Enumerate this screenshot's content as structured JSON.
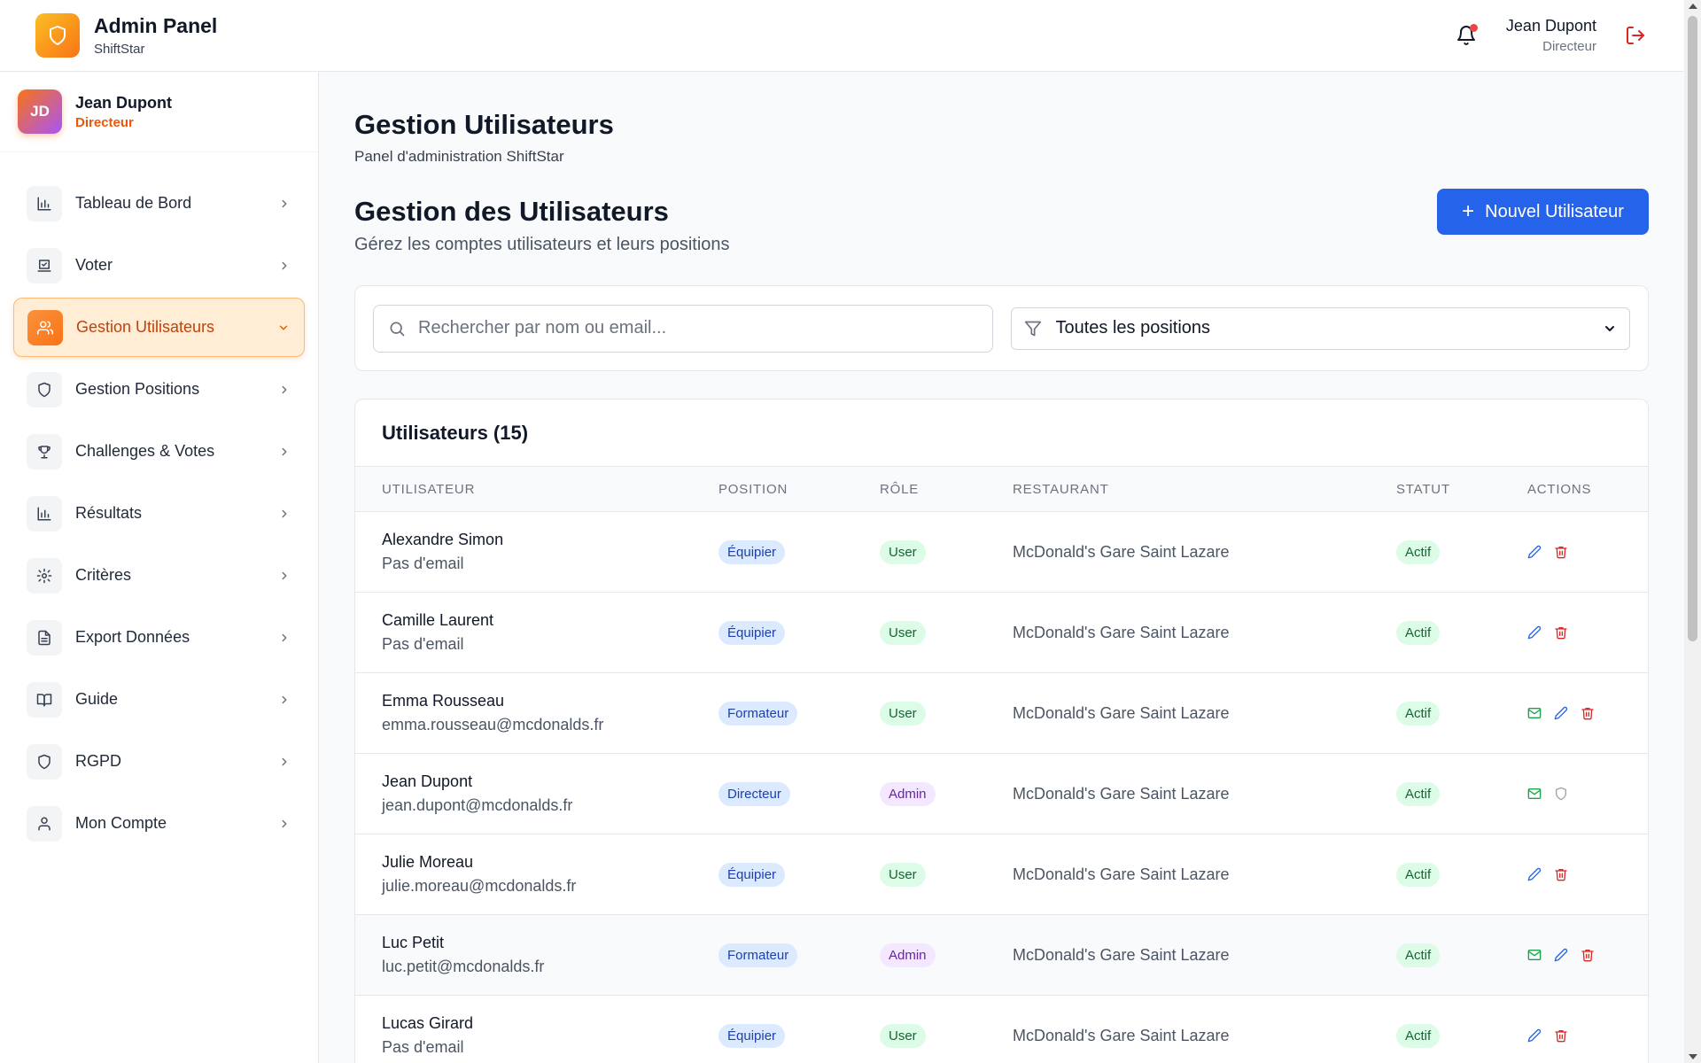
{
  "header": {
    "title": "Admin Panel",
    "subtitle": "ShiftStar",
    "user_name": "Jean Dupont",
    "user_role": "Directeur",
    "icons": {
      "logo": "shield-icon",
      "notifications": "bell-icon",
      "logout": "logout-icon"
    }
  },
  "sidebar": {
    "profile": {
      "initials": "JD",
      "name": "Jean Dupont",
      "role": "Directeur"
    },
    "items": [
      {
        "label": "Tableau de Bord",
        "icon": "bar-chart-icon",
        "active": false
      },
      {
        "label": "Voter",
        "icon": "vote-icon",
        "active": false
      },
      {
        "label": "Gestion Utilisateurs",
        "icon": "users-icon",
        "active": true
      },
      {
        "label": "Gestion Positions",
        "icon": "shield-icon",
        "active": false
      },
      {
        "label": "Challenges & Votes",
        "icon": "trophy-icon",
        "active": false
      },
      {
        "label": "Résultats",
        "icon": "bar-chart-icon",
        "active": false
      },
      {
        "label": "Critères",
        "icon": "gear-icon",
        "active": false
      },
      {
        "label": "Export Données",
        "icon": "file-text-icon",
        "active": false
      },
      {
        "label": "Guide",
        "icon": "book-icon",
        "active": false
      },
      {
        "label": "RGPD",
        "icon": "shield-icon",
        "active": false
      },
      {
        "label": "Mon Compte",
        "icon": "user-icon",
        "active": false
      }
    ]
  },
  "main": {
    "page_title": "Gestion Utilisateurs",
    "page_subtitle": "Panel d'administration ShiftStar",
    "section_title": "Gestion des Utilisateurs",
    "section_subtitle": "Gérez les comptes utilisateurs et leurs positions",
    "new_button": "Nouvel Utilisateur",
    "search_placeholder": "Rechercher par nom ou email...",
    "filter_value": "Toutes les positions",
    "table_title": "Utilisateurs (15)",
    "columns": [
      "UTILISATEUR",
      "POSITION",
      "RÔLE",
      "RESTAURANT",
      "STATUT",
      "ACTIONS"
    ],
    "rows": [
      {
        "name": "Alexandre Simon",
        "email": "Pas d'email",
        "position": "Équipier",
        "role": "User",
        "restaurant": "McDonald's Gare Saint Lazare",
        "status": "Actif",
        "actions": [
          "edit",
          "delete"
        ]
      },
      {
        "name": "Camille Laurent",
        "email": "Pas d'email",
        "position": "Équipier",
        "role": "User",
        "restaurant": "McDonald's Gare Saint Lazare",
        "status": "Actif",
        "actions": [
          "edit",
          "delete"
        ]
      },
      {
        "name": "Emma Rousseau",
        "email": "emma.rousseau@mcdonalds.fr",
        "position": "Formateur",
        "role": "User",
        "restaurant": "McDonald's Gare Saint Lazare",
        "status": "Actif",
        "actions": [
          "mail",
          "edit",
          "delete"
        ]
      },
      {
        "name": "Jean Dupont",
        "email": "jean.dupont@mcdonalds.fr",
        "position": "Directeur",
        "role": "Admin",
        "restaurant": "McDonald's Gare Saint Lazare",
        "status": "Actif",
        "actions": [
          "mail",
          "shield"
        ]
      },
      {
        "name": "Julie Moreau",
        "email": "julie.moreau@mcdonalds.fr",
        "position": "Équipier",
        "role": "User",
        "restaurant": "McDonald's Gare Saint Lazare",
        "status": "Actif",
        "actions": [
          "edit",
          "delete"
        ]
      },
      {
        "name": "Luc Petit",
        "email": "luc.petit@mcdonalds.fr",
        "position": "Formateur",
        "role": "Admin",
        "restaurant": "McDonald's Gare Saint Lazare",
        "status": "Actif",
        "actions": [
          "mail",
          "edit",
          "delete"
        ]
      },
      {
        "name": "Lucas Girard",
        "email": "Pas d'email",
        "position": "Équipier",
        "role": "User",
        "restaurant": "McDonald's Gare Saint Lazare",
        "status": "Actif",
        "actions": [
          "edit",
          "delete"
        ]
      }
    ]
  },
  "colors": {
    "accent": "#2563eb",
    "brand_orange": "#f97316",
    "active_nav_bg": "#ffedd5",
    "danger": "#dc2626",
    "success": "#16a34a"
  }
}
